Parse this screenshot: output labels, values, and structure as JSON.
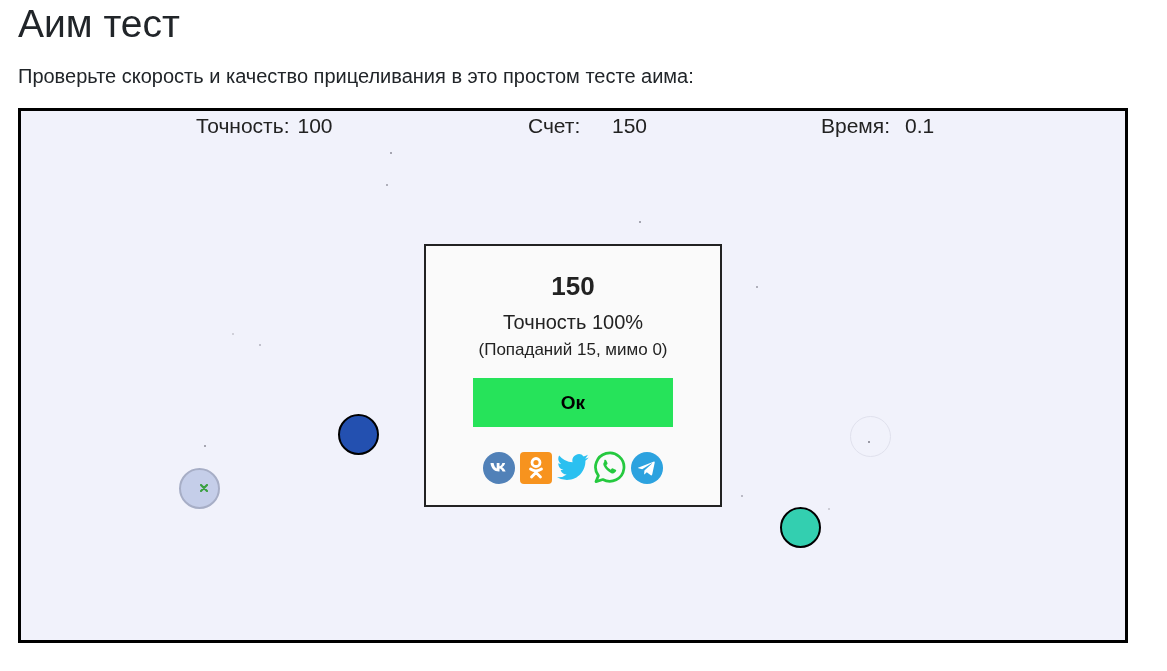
{
  "page": {
    "title": "Аим тест",
    "intro": "Проверьте скорость и качество прицеливания в это простом тесте аима:"
  },
  "game": {
    "stats": [
      {
        "label": "Точность:",
        "value": "100"
      },
      {
        "label": "Счет:",
        "value": "150"
      },
      {
        "label": "Время:",
        "value": "0.1"
      }
    ],
    "targets": [
      {
        "kind": "live",
        "color": "#2350b0"
      },
      {
        "kind": "fading"
      },
      {
        "kind": "hit"
      },
      {
        "kind": "live",
        "color": "#33cfb0"
      }
    ],
    "result": {
      "score": "150",
      "accuracy": "Точность 100%",
      "details": "(Попаданий 15, мимо 0)",
      "button": "Ок",
      "share": [
        {
          "kind": "vk"
        },
        {
          "kind": "ok"
        },
        {
          "kind": "twitter"
        },
        {
          "kind": "whatsapp"
        },
        {
          "kind": "telegram"
        }
      ]
    }
  }
}
